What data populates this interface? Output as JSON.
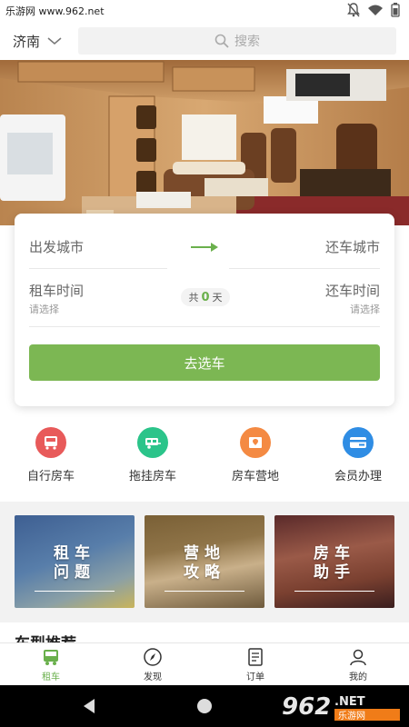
{
  "status_bar": {
    "watermark": "乐游网 www.962.net"
  },
  "header": {
    "city": "济南",
    "search_placeholder": "搜索"
  },
  "booking": {
    "from_city": "出发城市",
    "to_city": "还车城市",
    "pickup_label": "租车时间",
    "pickup_hint": "请选择",
    "return_label": "还车时间",
    "return_hint": "请选择",
    "days_prefix": "共",
    "days_value": "0",
    "days_suffix": "天",
    "go_button": "去选车"
  },
  "quick_links": [
    {
      "label": "自行房车",
      "icon": "bus-icon",
      "color": "#e85a5a"
    },
    {
      "label": "拖挂房车",
      "icon": "trailer-icon",
      "color": "#2bc48a"
    },
    {
      "label": "房车营地",
      "icon": "map-icon",
      "color": "#f48a43"
    },
    {
      "label": "会员办理",
      "icon": "card-icon",
      "color": "#2f8de4"
    }
  ],
  "promos": [
    {
      "line1": "租车",
      "line2": "问题"
    },
    {
      "line1": "营地",
      "line2": "攻略"
    },
    {
      "line1": "房车",
      "line2": "助手"
    }
  ],
  "section": {
    "title": "车型推荐"
  },
  "bottom_nav": [
    {
      "label": "租车",
      "icon": "bus-icon",
      "active": true
    },
    {
      "label": "发现",
      "icon": "compass-icon",
      "active": false
    },
    {
      "label": "订单",
      "icon": "order-icon",
      "active": false
    },
    {
      "label": "我的",
      "icon": "user-icon",
      "active": false
    }
  ],
  "colors": {
    "accent": "#7cb753",
    "accent_text": "#6ab04c"
  },
  "brand_logo": "962 NET 乐游网"
}
